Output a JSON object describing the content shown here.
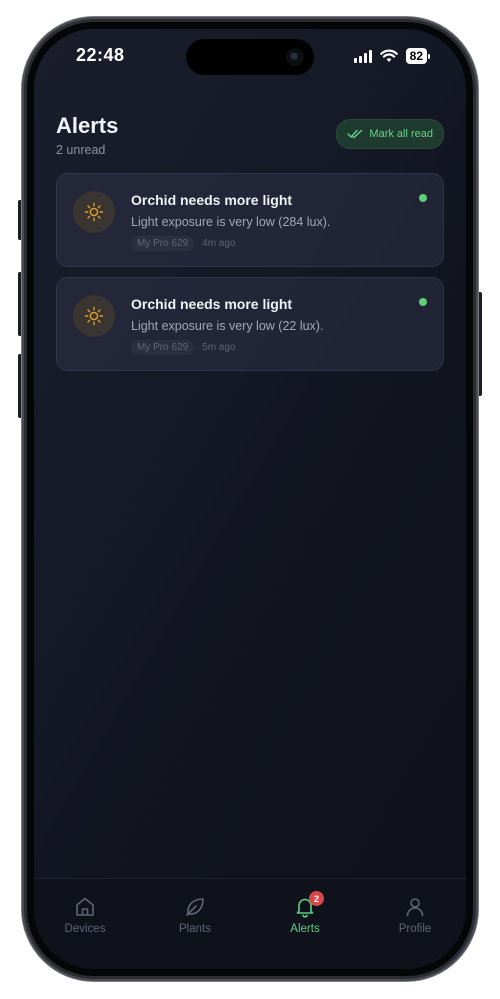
{
  "status_bar": {
    "time": "22:48",
    "battery": "82"
  },
  "header": {
    "title": "Alerts",
    "subtitle": "2 unread",
    "mark_all_label": "Mark all read"
  },
  "alerts": [
    {
      "title": "Orchid needs more light",
      "message": "Light exposure is very low (284 lux).",
      "device": "My Pro 629",
      "time": "4m ago",
      "unread": true,
      "icon": "sun-icon"
    },
    {
      "title": "Orchid needs more light",
      "message": "Light exposure is very low (22 lux).",
      "device": "My Pro 629",
      "time": "5m ago",
      "unread": true,
      "icon": "sun-icon"
    }
  ],
  "tabbar": {
    "tabs": [
      {
        "label": "Devices",
        "icon": "home-icon"
      },
      {
        "label": "Plants",
        "icon": "leaf-icon"
      },
      {
        "label": "Alerts",
        "icon": "bell-icon",
        "badge": "2",
        "active": true
      },
      {
        "label": "Profile",
        "icon": "user-icon"
      }
    ]
  },
  "colors": {
    "accent": "#5ed07c",
    "badge": "#d9464a",
    "background": "#11141f"
  }
}
